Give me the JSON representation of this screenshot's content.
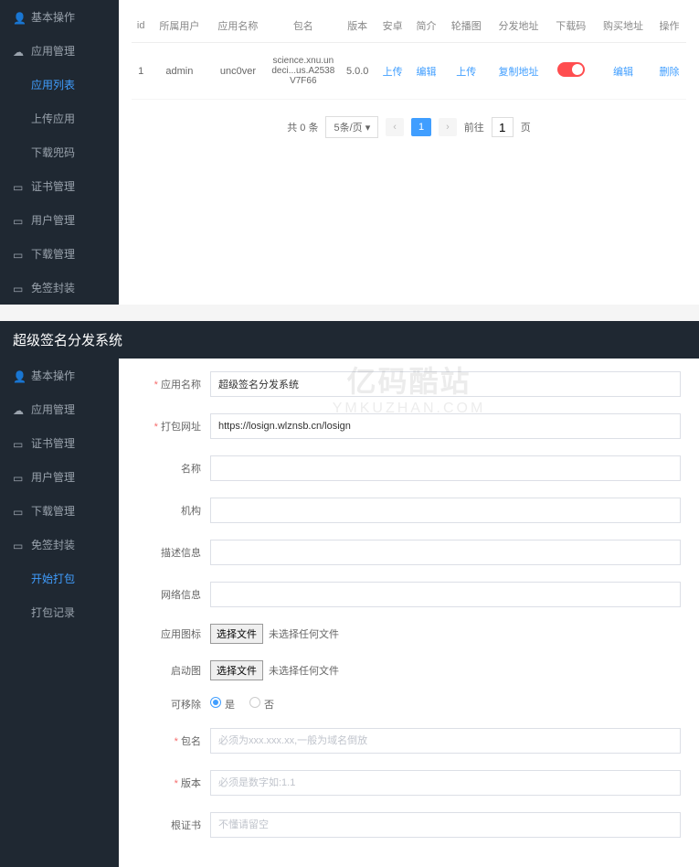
{
  "top": {
    "sidebar": [
      {
        "label": "基本操作",
        "icon": "user"
      },
      {
        "label": "应用管理",
        "icon": "cloud"
      },
      {
        "label": "应用列表",
        "sub": true,
        "active": true
      },
      {
        "label": "上传应用",
        "sub": true
      },
      {
        "label": "下载兜码",
        "sub": true
      },
      {
        "label": "证书管理",
        "icon": "doc"
      },
      {
        "label": "用户管理",
        "icon": "doc"
      },
      {
        "label": "下载管理",
        "icon": "doc"
      },
      {
        "label": "免签封装",
        "icon": "doc"
      }
    ],
    "table": {
      "headers": [
        "id",
        "所属用户",
        "应用名称",
        "包名",
        "版本",
        "安卓",
        "简介",
        "轮播图",
        "分发地址",
        "下载码",
        "购买地址",
        "操作"
      ],
      "row": {
        "id": "1",
        "user": "admin",
        "app": "unc0ver",
        "pkg": "science.xnu.undeci...us.A2538V7F66",
        "ver": "5.0.0",
        "android": "上传",
        "intro": "编辑",
        "carousel": "上传",
        "dist": "复制地址",
        "buy": "编辑",
        "op": "删除"
      }
    },
    "pagination": {
      "total": "共 0 条",
      "pagesize": "5条/页",
      "current": "1",
      "goto_label": "前往",
      "goto_value": "1",
      "goto_unit": "页"
    }
  },
  "bottom": {
    "title": "超级签名分发系统",
    "sidebar": [
      {
        "label": "基本操作",
        "icon": "user"
      },
      {
        "label": "应用管理",
        "icon": "cloud"
      },
      {
        "label": "证书管理",
        "icon": "doc"
      },
      {
        "label": "用户管理",
        "icon": "doc"
      },
      {
        "label": "下载管理",
        "icon": "doc"
      },
      {
        "label": "免签封装",
        "icon": "doc"
      },
      {
        "label": "开始打包",
        "sub": true,
        "active": true
      },
      {
        "label": "打包记录",
        "sub": true
      }
    ],
    "form": {
      "app_name_label": "应用名称",
      "app_name_value": "超级签名分发系统",
      "url_label": "打包网址",
      "url_value": "https://losign.wlznsb.cn/losign",
      "name_label": "名称",
      "org_label": "机构",
      "desc_label": "描述信息",
      "net_label": "网络信息",
      "icon_label": "应用图标",
      "launch_label": "启动图",
      "file_btn": "选择文件",
      "file_empty": "未选择任何文件",
      "removable_label": "可移除",
      "radio_yes": "是",
      "radio_no": "否",
      "pkg_label": "包名",
      "pkg_placeholder": "必须为xxx.xxx.xx,一般为域名倒放",
      "ver_label": "版本",
      "ver_placeholder": "必须是数字如:1.1",
      "cert_label": "根证书",
      "cert_placeholder": "不懂请留空"
    },
    "watermark": {
      "main": "亿码酷站",
      "sub": "YMKUZHAN.COM"
    }
  }
}
